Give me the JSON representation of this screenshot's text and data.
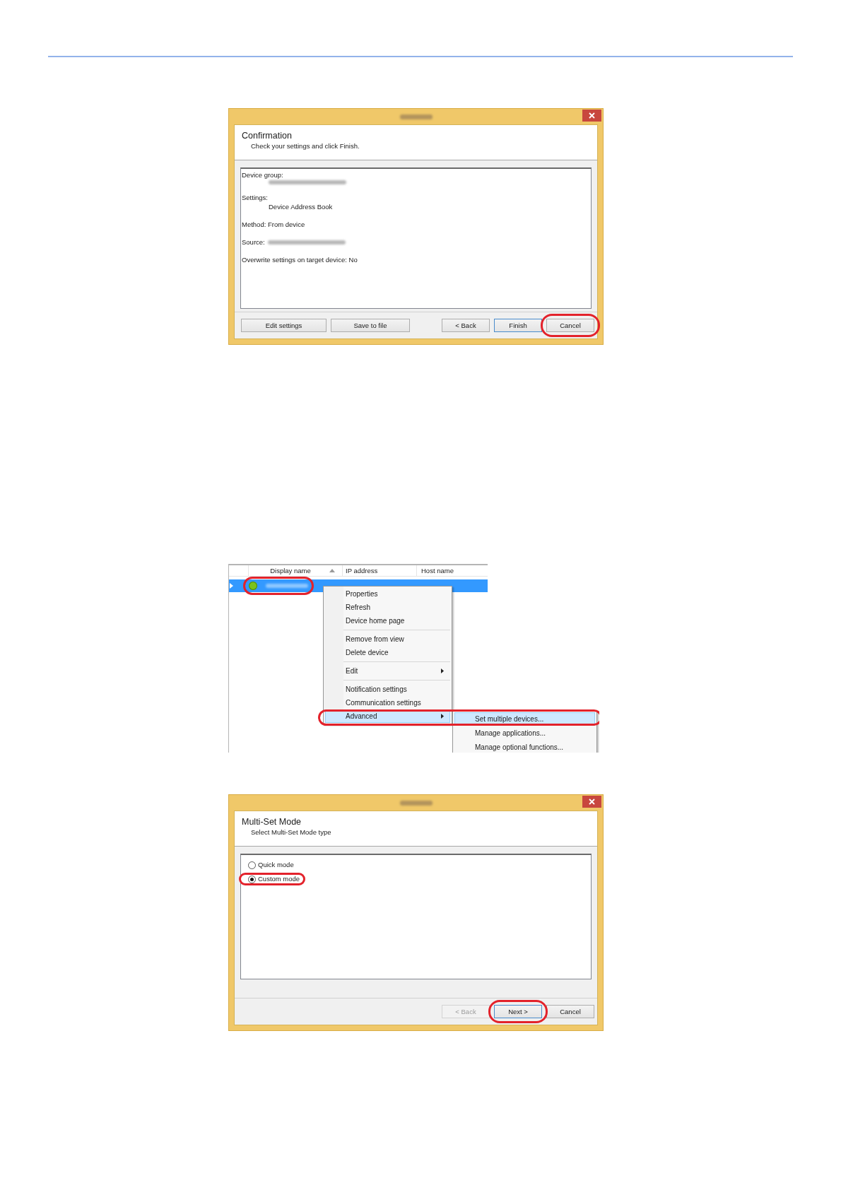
{
  "confirmation_dialog": {
    "title_blurred": true,
    "heading": "Confirmation",
    "subheading": "Check your settings and click Finish.",
    "body": {
      "kind": "summary",
      "lines": [
        {
          "kind": "label",
          "text": "Device group:"
        },
        {
          "kind": "blurred_value"
        },
        {
          "kind": "label",
          "text": "Settings:"
        },
        {
          "kind": "value",
          "text": "Device Address Book"
        },
        {
          "kind": "label",
          "text": "Method: From device"
        },
        {
          "kind": "label_blurred",
          "text": "Source:"
        },
        {
          "kind": "label",
          "text": "Overwrite settings on target device: No"
        }
      ]
    },
    "buttons": [
      {
        "label": "Edit settings",
        "kind": "secondary",
        "default": false,
        "disabled": false,
        "highlighted": false
      },
      {
        "label": "Save to file",
        "kind": "secondary",
        "default": false,
        "disabled": false,
        "highlighted": false
      },
      {
        "label": "< Back",
        "kind": "nav",
        "default": false,
        "disabled": false,
        "highlighted": false
      },
      {
        "label": "Finish",
        "kind": "nav",
        "default": true,
        "disabled": false,
        "highlighted": false
      },
      {
        "label": "Cancel",
        "kind": "nav",
        "default": false,
        "disabled": false,
        "highlighted": true
      }
    ]
  },
  "device_list": {
    "columns": [
      {
        "label": "Display name",
        "sorted": true
      },
      {
        "label": "IP address",
        "sorted": false
      },
      {
        "label": "Host name",
        "sorted": false
      }
    ],
    "rows": [
      {
        "selected": true,
        "color": "#7cc21e",
        "name_blurred": true,
        "highlighted": true
      }
    ],
    "context_menu": [
      {
        "kind": "item",
        "label": "Properties",
        "submenu": false,
        "selected": false,
        "highlighted": false
      },
      {
        "kind": "item",
        "label": "Refresh",
        "submenu": false,
        "selected": false,
        "highlighted": false
      },
      {
        "kind": "item",
        "label": "Device home page",
        "submenu": false,
        "selected": false,
        "highlighted": false
      },
      {
        "kind": "separator"
      },
      {
        "kind": "item",
        "label": "Remove from view",
        "submenu": false,
        "selected": false,
        "highlighted": false
      },
      {
        "kind": "item",
        "label": "Delete device",
        "submenu": false,
        "selected": false,
        "highlighted": false
      },
      {
        "kind": "separator"
      },
      {
        "kind": "item",
        "label": "Edit",
        "submenu": true,
        "selected": false,
        "highlighted": false
      },
      {
        "kind": "separator"
      },
      {
        "kind": "item",
        "label": "Notification settings",
        "submenu": false,
        "selected": false,
        "highlighted": false
      },
      {
        "kind": "item",
        "label": "Communication settings",
        "submenu": false,
        "selected": false,
        "highlighted": false
      },
      {
        "kind": "item",
        "label": "Advanced",
        "submenu": true,
        "selected": true,
        "highlighted": true
      }
    ],
    "submenu": [
      {
        "label": "Set multiple devices...",
        "selected": true,
        "highlighted": true
      },
      {
        "label": "Manage applications...",
        "selected": false,
        "highlighted": false
      },
      {
        "label": "Manage optional functions...",
        "selected": false,
        "highlighted": false
      }
    ]
  },
  "multiset_dialog": {
    "title_blurred": true,
    "heading": "Multi-Set Mode",
    "subheading": "Select Multi-Set Mode type",
    "body": {
      "kind": "options",
      "options": [
        {
          "label": "Quick mode",
          "selected": false,
          "highlighted": false
        },
        {
          "label": "Custom mode",
          "selected": true,
          "highlighted": true
        }
      ]
    },
    "buttons": [
      {
        "label": "< Back",
        "kind": "nav",
        "default": false,
        "disabled": true,
        "highlighted": false
      },
      {
        "label": "Next >",
        "kind": "nav",
        "default": true,
        "disabled": false,
        "highlighted": true
      },
      {
        "label": "Cancel",
        "kind": "nav",
        "default": false,
        "disabled": false,
        "highlighted": false
      }
    ]
  }
}
